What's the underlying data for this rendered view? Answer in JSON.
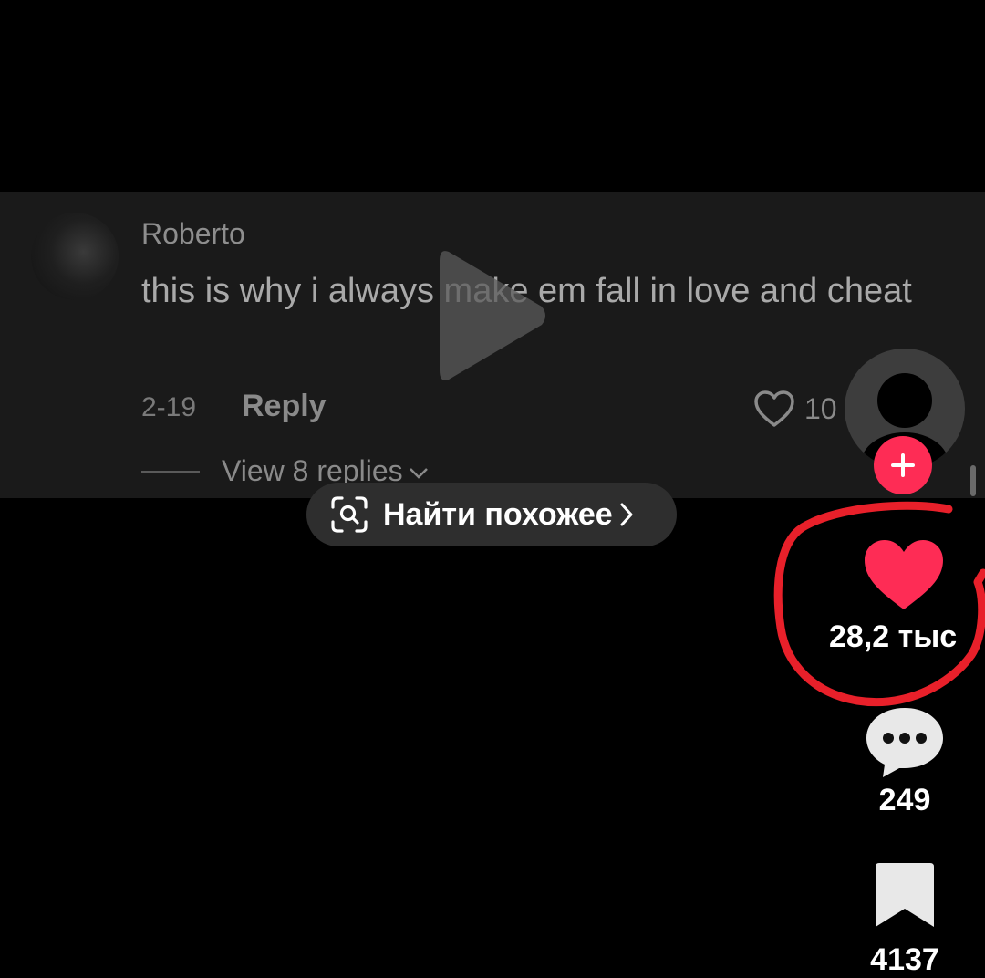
{
  "comment": {
    "username": "Roberto",
    "text": "this is why i always make em fall in love and cheat",
    "date": "2-19",
    "reply_label": "Reply",
    "like_count": "10",
    "view_replies_label": "View 8 replies"
  },
  "find_similar": {
    "label": "Найти похожее"
  },
  "actions": {
    "like_count": "28,2 тыс",
    "comment_count": "249",
    "save_count": "4137"
  },
  "colors": {
    "accent": "#fe2c55",
    "annotation": "#e8202a",
    "background": "#000000",
    "video_panel": "#1a1a1a"
  },
  "icons": [
    "play-icon",
    "heart-outline-icon",
    "chevron-down-icon",
    "scan-search-icon",
    "chevron-right-icon",
    "plus-icon",
    "heart-icon",
    "comment-bubble-icon",
    "bookmark-icon"
  ]
}
